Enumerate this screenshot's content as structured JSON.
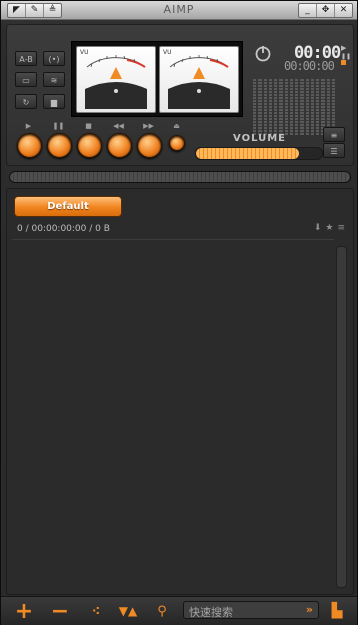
{
  "window": {
    "title": "AIMP"
  },
  "titlebar_left": {
    "icons": [
      "menu-icon",
      "settings-icon",
      "minimize-to-tray-icon"
    ]
  },
  "titlebar_right": {
    "icons": [
      "minimize-icon",
      "pin-icon",
      "close-icon"
    ]
  },
  "left_buttons": [
    "A-B",
    "(1)",
    "folder",
    "wave",
    "repeat",
    "equalizer"
  ],
  "vu_meters": {
    "scale_left": "VU",
    "scale_right": "VU"
  },
  "time": {
    "main": "00:00",
    "remaining": "00:00:00"
  },
  "transport": [
    "play",
    "pause",
    "stop",
    "prev",
    "next"
  ],
  "volume": {
    "label": "VOLUME",
    "level": 0.82
  },
  "playlist": {
    "tab": "Default",
    "info": "0 / 00:00:00:00 / 0 B"
  },
  "bottom": {
    "search_placeholder": "快速搜索"
  },
  "colors": {
    "accent": "#f08a24",
    "background": "#2b2b2b"
  }
}
